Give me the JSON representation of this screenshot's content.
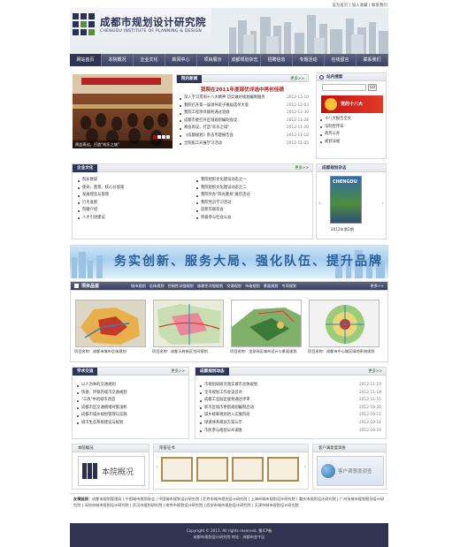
{
  "top_links": "设为首页 | 加入收藏 | 联系我们",
  "header": {
    "title": "成都市规划设计研究院",
    "subtitle": "CHENGDU INSTITUTE OF PLANNING & DESIGN"
  },
  "nav": [
    "网站首页",
    "本院概况",
    "企业文化",
    "新闻中心",
    "项目展示",
    "成都规划杂志",
    "招聘信息",
    "专题活动",
    "在线留言",
    "联系我们"
  ],
  "news": {
    "title": "院内新闻",
    "more": "更多>>",
    "photo_caption": "两会再议，打造\"欢乐之城\"",
    "headline": "我院在2011年度部优评选中再创佳绩",
    "items": [
      {
        "text": "深入学习贯彻十八大精神 切实做好规划编制服务",
        "date": "2012-12-10"
      },
      {
        "text": "我院召开第一届领导班子换届选举大会",
        "date": "2012-12-03"
      },
      {
        "text": "我院工程项目顺利通过验收",
        "date": "2012-11-30"
      },
      {
        "text": "成都市委召开区域规划编制会议",
        "date": "2012-11-28"
      },
      {
        "text": "两会再议，打造\"欢乐之城\"",
        "date": "2012-11-20"
      },
      {
        "text": "《成都规划》杂志专题报告会",
        "date": "2012-11-18"
      },
      {
        "text": "全院职工开展学习活动",
        "date": "2012-11-05"
      }
    ]
  },
  "site_search": {
    "title": "站内搜索",
    "go": "GO",
    "links": [
      "党的十八大",
      "十八大报告全文",
      "法制宣传日",
      "政务公开",
      "规划法规"
    ]
  },
  "culture": {
    "title": "企业文化",
    "more": "更多>>",
    "left": [
      "院长致辞",
      "使命、愿景、核心价值观",
      "发展理念与管理",
      "行为准则",
      "院徽介绍",
      "人才引进建议"
    ],
    "right": [
      "我院组织文化建设动态之一",
      "我院组织文化建设动态之二",
      "我院举办\"阳光健身\"展示活动",
      "我院党员学习活动",
      "迎新年联欢会",
      "积极参与社会公益"
    ]
  },
  "magazine": {
    "title": "成都规划杂志",
    "cover_title": "CHENGDU",
    "issue": "2012年第2期"
  },
  "banner": {
    "text": "务实创新、服务大局、强化队伍、提升品牌"
  },
  "projects": {
    "title": "项目品鉴",
    "more": "更多>>",
    "tabs": [
      "城市规划",
      "总体规划",
      "控制性详细规划",
      "修建性详细规划",
      "交通规划",
      "市政规划",
      "景观规划",
      "专项规划"
    ],
    "captions": [
      "项目名称：成都市城市总体规划",
      "项目名称：成都天府新区空间规划",
      "项目名称：龙泉驿区城市设计与景观规划",
      "项目名称：成都市中心城区绿地系统规划"
    ]
  },
  "study": {
    "title": "学术交流",
    "more": "更多>>",
    "items": [
      "以人为本的交通规划",
      "快速、环保的城市交通规划",
      "\"三改\"中的城市改造",
      "成都市区交通拥堵对策浅析",
      "成都市城乡规划管理与实践",
      "城市生态系统建设与规划"
    ]
  },
  "dynamics": {
    "title": "成都规划动态",
    "more": "更多>>",
    "items": [
      {
        "text": "市规划局研究落实城市总体规划",
        "date": "2012-11-19"
      },
      {
        "text": "全市规划工作会议召开",
        "date": "2012-11-18"
      },
      {
        "text": "成都工业园区规划通过评审",
        "date": "2012-11-15"
      },
      {
        "text": "新市区城市更新规划编制启动",
        "date": "2012-10-26"
      },
      {
        "text": "城乡统筹规划进入实施阶段",
        "date": "2012-10-11"
      },
      {
        "text": "绿道体系规划方案公示",
        "date": "2012-10-11"
      },
      {
        "text": "市民参与规划公众调查",
        "date": "2012-10-10"
      }
    ]
  },
  "bottom_blocks": {
    "intro_title": "本院概况",
    "intro_label": "本院概况",
    "cert_title": "荣誉证书",
    "survey_title": "客户满意度调查",
    "survey_label": "客户满意度调查"
  },
  "friend_links": {
    "label": "友情链接：",
    "text": "成都市规划管理局 | 中国城市规划协会 | 中国城市规划设计研究院 | 北京市城市规划设计研究院 | 上海市城市规划设计研究院 | 重庆市规划设计研究院 | 广州市城市规划勘测设计研究院 | 深圳市城市规划设计研究院 | 武汉市规划研究院 | 南京市规划设计研究院 | 西安市城市规划设计研究院 | 天津市城市规划设计研究院"
  },
  "footer": {
    "line1": "Copyright © 2011. All rights reserved. 蜀ICP备",
    "line2": "成都市规划设计研究院  地址：成都市金牛区"
  }
}
